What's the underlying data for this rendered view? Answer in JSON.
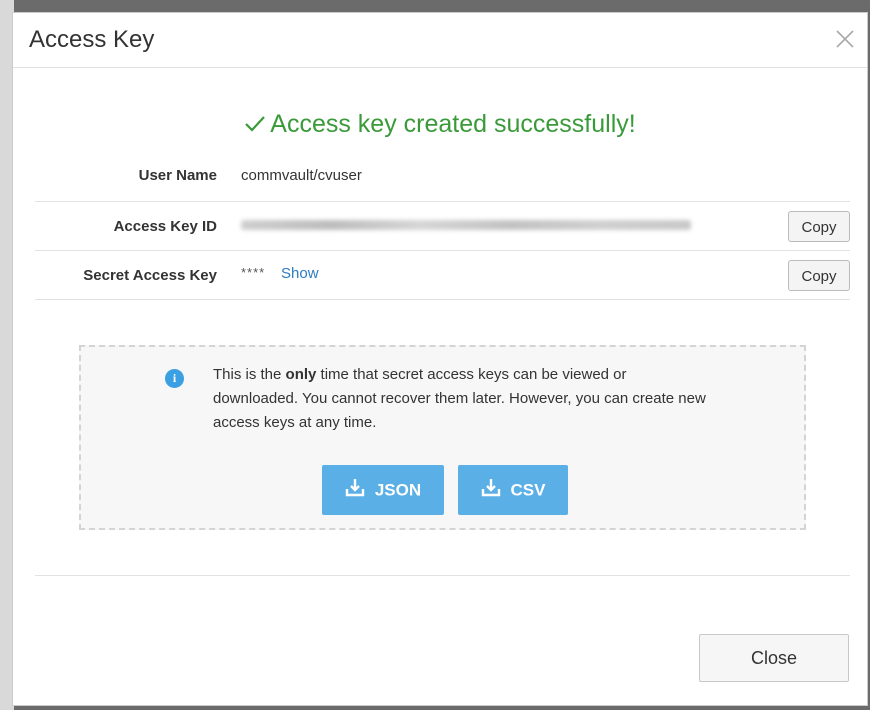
{
  "modal": {
    "title": "Access Key",
    "close_icon": "close-icon"
  },
  "success": {
    "icon": "checkmark-icon",
    "message": "Access key created successfully!",
    "color": "#3a9a3a"
  },
  "fields": {
    "user_name": {
      "label": "User Name",
      "value": "commvault/cvuser"
    },
    "access_key_id": {
      "label": "Access Key ID",
      "copy_label": "Copy"
    },
    "secret_access_key": {
      "label": "Secret Access Key",
      "masked": "****",
      "show_label": "Show",
      "copy_label": "Copy"
    }
  },
  "notice": {
    "icon": "info-icon",
    "text_before": "This is the ",
    "text_bold": "only",
    "text_after": " time that secret access keys can be viewed or downloaded. You cannot recover them later. However, you can create new access keys at any time."
  },
  "downloads": {
    "json_label": "JSON",
    "csv_label": "CSV",
    "icon": "download-icon",
    "color": "#5aafe6"
  },
  "footer": {
    "close_label": "Close"
  }
}
